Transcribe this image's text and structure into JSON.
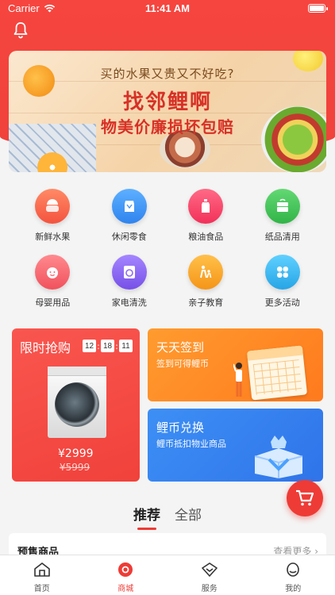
{
  "status_bar": {
    "carrier": "Carrier",
    "time": "11:41 AM"
  },
  "header": {
    "icon": "bell-icon"
  },
  "banner": {
    "line1": "买的水果又贵又不好吃?",
    "line2": "找邻鲤啊",
    "line3": "物美价廉损坏包赔"
  },
  "categories": [
    {
      "label": "新鲜水果",
      "icon": "fruit-basket-icon",
      "color": "#f86d52"
    },
    {
      "label": "休闲零食",
      "icon": "snack-bag-icon",
      "color": "#3f98f6"
    },
    {
      "label": "粮油食品",
      "icon": "oil-bottle-icon",
      "color": "#f8456a"
    },
    {
      "label": "纸品清用",
      "icon": "tissue-box-icon",
      "color": "#46c85a"
    },
    {
      "label": "母婴用品",
      "icon": "baby-face-icon",
      "color": "#f76b73"
    },
    {
      "label": "家电清洗",
      "icon": "washing-machine-icon",
      "color": "#8f6bf1"
    },
    {
      "label": "亲子教育",
      "icon": "parent-child-icon",
      "color": "#fbaa2d"
    },
    {
      "label": "更多活动",
      "icon": "clover-icon",
      "color": "#3fbdf2"
    }
  ],
  "flash_sale": {
    "title": "限时抢购",
    "timer": [
      "12",
      "18",
      "11"
    ],
    "price": "¥2999",
    "original_price": "¥5999"
  },
  "checkin": {
    "title": "天天签到",
    "subtitle": "签到可得鲤币"
  },
  "exchange": {
    "title": "鲤币兑换",
    "subtitle": "鲤币抵扣物业商品"
  },
  "tabs": [
    {
      "label": "推荐",
      "active": true
    },
    {
      "label": "全部",
      "active": false
    }
  ],
  "presale": {
    "title": "预售商品",
    "more": "查看更多 ›"
  },
  "tabbar": [
    {
      "label": "首页",
      "icon": "home-icon",
      "active": false
    },
    {
      "label": "商城",
      "icon": "mall-icon",
      "active": true
    },
    {
      "label": "服务",
      "icon": "service-icon",
      "active": false
    },
    {
      "label": "我的",
      "icon": "profile-icon",
      "active": false
    }
  ],
  "colors": {
    "accent": "#ee3b36",
    "orange": "#ff8a24",
    "blue": "#3585f0"
  }
}
